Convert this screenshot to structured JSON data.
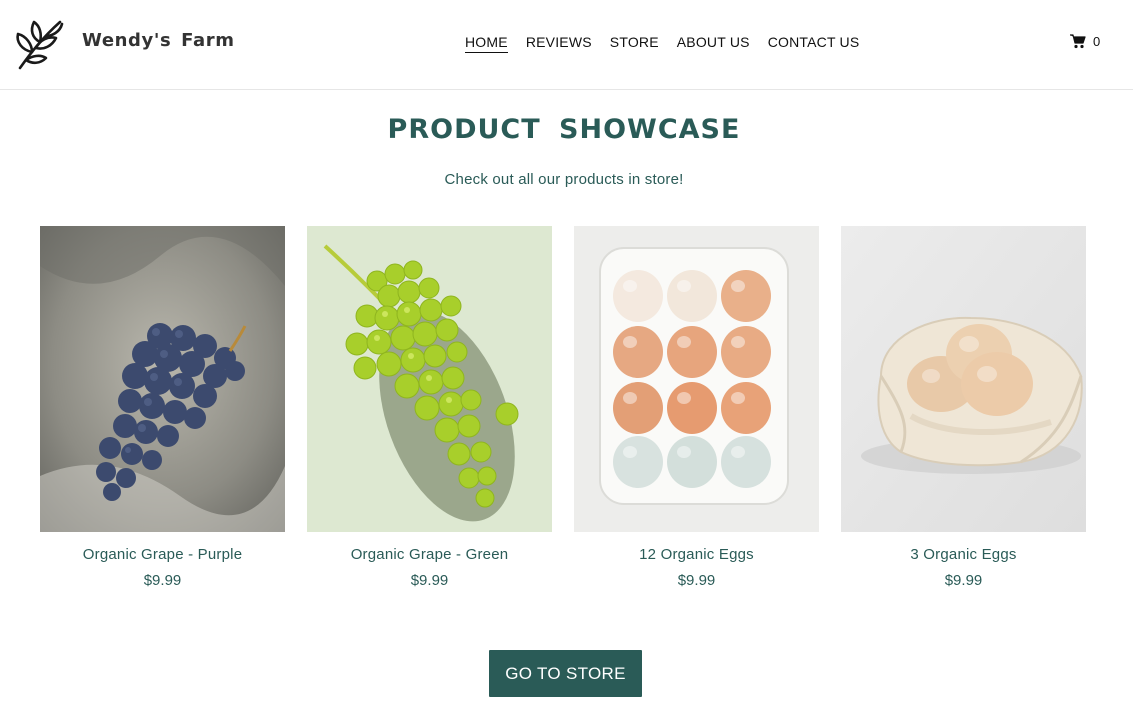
{
  "brand": {
    "name": "Wendy's  Farm",
    "logo_icon": "leaf-branch-icon"
  },
  "nav": {
    "items": [
      {
        "label": "HOME",
        "active": true
      },
      {
        "label": "REVIEWS",
        "active": false
      },
      {
        "label": "STORE",
        "active": false
      },
      {
        "label": "ABOUT US",
        "active": false
      },
      {
        "label": "CONTACT US",
        "active": false
      }
    ]
  },
  "cart": {
    "icon": "shopping-cart-icon",
    "count": "0"
  },
  "showcase": {
    "title": "PRODUCT  SHOWCASE",
    "subtitle": "Check out all our products in store!",
    "products": [
      {
        "name": "Organic Grape - Purple",
        "price": "$9.99",
        "image": "purple-grapes-photo"
      },
      {
        "name": "Organic Grape - Green",
        "price": "$9.99",
        "image": "green-grapes-photo"
      },
      {
        "name": "12 Organic Eggs",
        "price": "$9.99",
        "image": "egg-carton-photo"
      },
      {
        "name": "3 Organic Eggs",
        "price": "$9.99",
        "image": "eggs-in-bag-photo"
      }
    ],
    "cta_label": "GO TO STORE"
  },
  "colors": {
    "accent": "#2a5b57",
    "text": "#111111",
    "border": "#e6e6e6"
  }
}
